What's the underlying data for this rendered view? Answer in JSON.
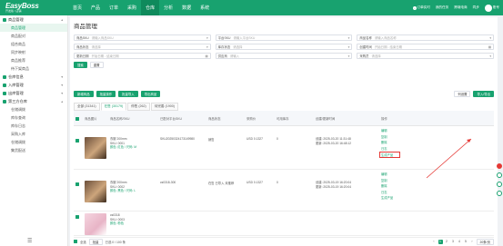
{
  "app": {
    "brand": "EasyBoss",
    "sub": "开发版 / 店铺"
  },
  "nav": [
    "首页",
    "产品",
    "订单",
    "采购",
    "仓库",
    "分析",
    "数据",
    "系统"
  ],
  "top_right": {
    "item1": "订单实时",
    "item2": "我的任务",
    "item3": "跨境电商",
    "item4": "同步",
    "user": "账号"
  },
  "sidebar": {
    "group1": "商品管理",
    "items1": [
      "商品管理",
      "商品配对",
      "组合商品",
      "同步映射",
      "商品推荐",
      "待下架商品"
    ],
    "group2": "仓库信息",
    "group3": "入库管理",
    "group4": "出库管理",
    "group5": "第三方仓库",
    "items5": [
      "仓储调拨",
      "库存查询",
      "库存日志",
      "采购入库",
      "仓储调拨",
      "集货配送"
    ]
  },
  "page": {
    "title": "商品管理"
  },
  "filters": {
    "row1": [
      {
        "label": "商品SKU",
        "placeholder": "请输入商品SKU"
      },
      {
        "label": "平台SKU",
        "placeholder": "请输入平台SKU"
      },
      {
        "label": "商品名称",
        "placeholder": "请输入商品名称"
      }
    ],
    "row2": [
      {
        "label": "商品状态",
        "placeholder": "请选择"
      },
      {
        "label": "库存状态",
        "placeholder": "请选择"
      },
      {
        "label": "创建时间",
        "placeholder": "开始日期 - 结束日期"
      }
    ],
    "row3": [
      {
        "label": "更新日期",
        "placeholder": "开始日期 - 结束日期"
      },
      {
        "label": "供应商",
        "placeholder": "请输入"
      },
      {
        "label": "采购员",
        "placeholder": "请选择"
      }
    ],
    "search": "搜索",
    "reset": "重置"
  },
  "toolbar": {
    "b1": "新增商品",
    "b2": "批量操作",
    "b3": "批量导入",
    "b4": "导出商品",
    "r1": "列设置",
    "r2": "导入/导出"
  },
  "tabs": [
    "全部 (31341)",
    "在售 (30179)",
    "停售 (262)",
    "待完善 (1900)"
  ],
  "table": {
    "headers": [
      "商品图片",
      "商品名称/SKU",
      "已配对平台SKU",
      "商品状态",
      "采购价",
      "可用库存",
      "创建/更新时间",
      "操作"
    ],
    "rows": [
      {
        "name": "衣服 200mm",
        "sku_line": "SKU: 0001",
        "spec": "颜色: 红色 / 尺码: M",
        "sku": "SKU20250324173149980",
        "status": "销售",
        "price": "USD 0.1327",
        "stock": "0",
        "created": "创建: 2025-03-20 11:31:48",
        "updated": "更新: 2025-03-20 16:48:12",
        "ops": [
          "编辑",
          "复制",
          "删除",
          "日志",
          "生成产品"
        ]
      },
      {
        "name": "衣服 200mm",
        "sku_line": "SKU: 0002",
        "spec": "颜色: 黑色 / 尺码: L",
        "sku": "cs0318-300",
        "status": "在售 已导入 未推荐",
        "price": "USD 0.1327",
        "stock": "0",
        "created": "创建: 2025-03-19 16:20:04",
        "updated": "更新: 2025-03-19 16:20:04",
        "ops": [
          "编辑",
          "复制",
          "删除",
          "日志",
          "生成产品"
        ]
      },
      {
        "name": "cs0318",
        "sku_line": "SKU: 0003",
        "spec": "颜色: 粉色",
        "sku": "",
        "status": "",
        "price": "",
        "stock": "",
        "created": "",
        "updated": "",
        "ops": []
      }
    ]
  },
  "footer": {
    "select_all": "全选",
    "batch": "批量",
    "summary": "已选 0 / 100 条",
    "pages": [
      "1",
      "2",
      "3",
      "4",
      "5"
    ],
    "page_size": "20条/页"
  }
}
